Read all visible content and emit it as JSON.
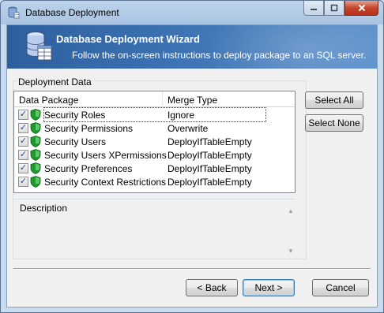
{
  "window": {
    "title": "Database Deployment"
  },
  "banner": {
    "title": "Database Deployment Wizard",
    "subtitle": "Follow the on-screen instructions to deploy package to an SQL server."
  },
  "deployment_data": {
    "group_label": "Deployment Data",
    "columns": [
      "Data Package",
      "Merge Type"
    ],
    "rows": [
      {
        "package": "Security Roles",
        "merge_type": "Ignore",
        "checked": true
      },
      {
        "package": "Security Permissions",
        "merge_type": "Overwrite",
        "checked": true
      },
      {
        "package": "Security Users",
        "merge_type": "DeployIfTableEmpty",
        "checked": true
      },
      {
        "package": "Security Users XPermissions",
        "merge_type": "DeployIfTableEmpty",
        "checked": true
      },
      {
        "package": "Security Preferences",
        "merge_type": "DeployIfTableEmpty",
        "checked": true
      },
      {
        "package": "Security Context Restrictions",
        "merge_type": "DeployIfTableEmpty",
        "checked": true
      }
    ],
    "description_label": "Description"
  },
  "buttons": {
    "select_all": "Select All",
    "select_none": "Select None",
    "back": "< Back",
    "next": "Next >",
    "cancel": "Cancel"
  },
  "colors": {
    "banner_start": "#2e5f9e",
    "banner_end": "#5b8fcb",
    "shield_green": "#1f9a2c",
    "close_red": "#c7452e"
  },
  "icons": {
    "title": "database-app-icon",
    "banner": "database-table-icon",
    "row": "green-shield-icon",
    "check": "checkmark"
  }
}
